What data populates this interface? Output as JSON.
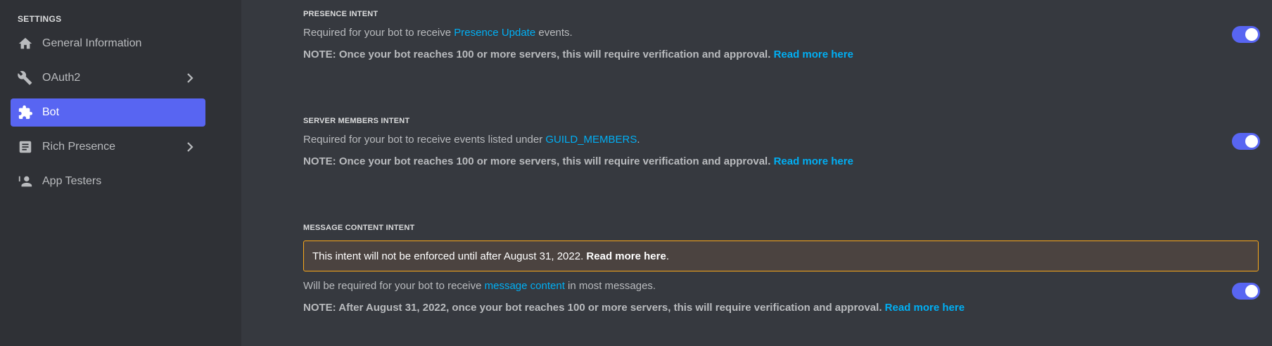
{
  "sidebar": {
    "title": "SETTINGS",
    "items": [
      {
        "label": "General Information",
        "icon": "home-icon"
      },
      {
        "label": "OAuth2",
        "icon": "wrench-icon"
      },
      {
        "label": "Bot",
        "icon": "puzzle-icon"
      },
      {
        "label": "Rich Presence",
        "icon": "document-icon"
      },
      {
        "label": "App Testers",
        "icon": "person-icon"
      }
    ],
    "active_item": "Bot",
    "accent_color": "#5865f2"
  },
  "intents": {
    "presence": {
      "title": "PRESENCE INTENT",
      "desc_prefix": "Required for your bot to receive ",
      "desc_link": "Presence Update",
      "desc_suffix": " events.",
      "note": "NOTE: Once your bot reaches 100 or more servers, this will require verification and approval.",
      "note_link": "Read more here",
      "enabled": true
    },
    "server_members": {
      "title": "SERVER MEMBERS INTENT",
      "desc_prefix": "Required for your bot to receive events listed under ",
      "desc_link": "GUILD_MEMBERS",
      "desc_suffix": ".",
      "note": "NOTE: Once your bot reaches 100 or more servers, this will require verification and approval.",
      "note_link": "Read more here",
      "enabled": true
    },
    "message_content": {
      "title": "MESSAGE CONTENT INTENT",
      "warning_text": "This intent will not be enforced until after August 31, 2022.",
      "warning_link": "Read more here",
      "warning_suffix": ".",
      "desc_prefix": "Will be required for your bot to receive ",
      "desc_link": "message content",
      "desc_suffix": " in most messages.",
      "note": "NOTE: After August 31, 2022, once your bot reaches 100 or more servers, this will require verification and approval.",
      "note_link": "Read more here",
      "enabled": true
    }
  },
  "colors": {
    "link": "#00aff4",
    "toggle_on": "#5865f2",
    "warning_border": "#faa81a"
  }
}
